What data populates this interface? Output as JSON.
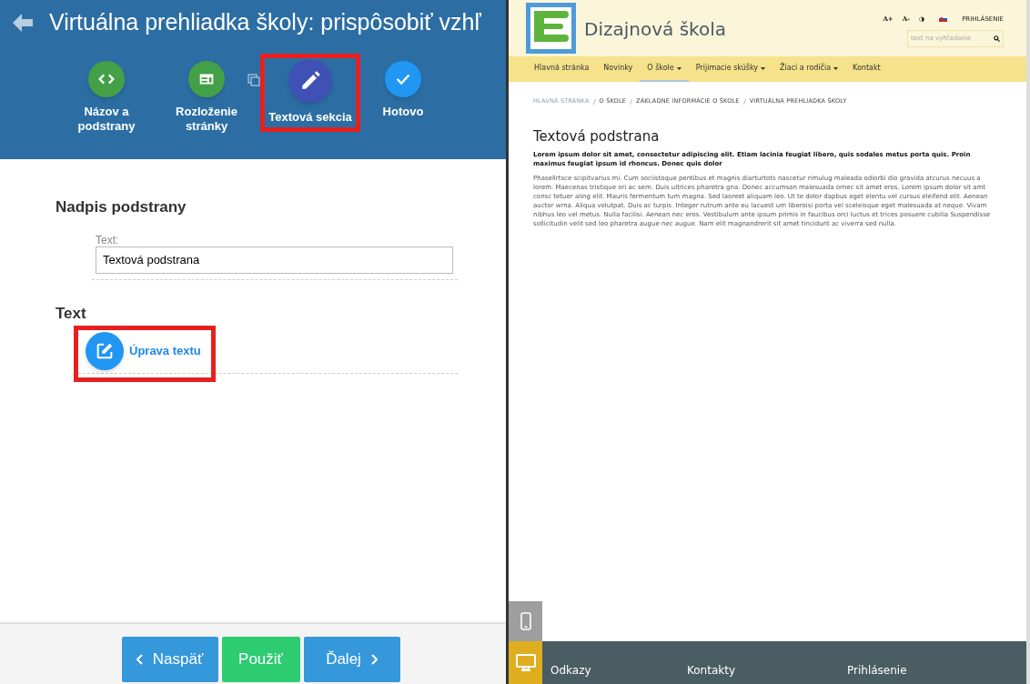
{
  "editor": {
    "title": "Virtuálna prehliadka školy: prispôsobiť vzhľ",
    "steps": [
      {
        "kind": "code",
        "label": "Názov a podstrany",
        "color": "#43a047",
        "selected": false,
        "highlighted": false
      },
      {
        "kind": "layout",
        "label": "Rozloženie stránky",
        "color": "#43a047",
        "selected": false,
        "highlighted": false
      },
      {
        "kind": "pencil",
        "label": "Textová sekcia",
        "color": "#3f51b5",
        "selected": true,
        "highlighted": true
      },
      {
        "kind": "check",
        "label": "Hotovo",
        "color": "#2196f3",
        "selected": false,
        "highlighted": false
      }
    ],
    "heading_section": {
      "title": "Nadpis podstrany",
      "field_label": "Text:",
      "field_value": "Textová podstrana"
    },
    "text_section": {
      "title": "Text",
      "edit_button": "Úprava textu",
      "highlighted": true
    },
    "buttons": [
      {
        "kind": "back",
        "label": "Naspäť",
        "color": "#3498db"
      },
      {
        "kind": "apply",
        "label": "Použiť",
        "color": "#2ecc71"
      },
      {
        "kind": "next",
        "label": "Ďalej",
        "color": "#3498db"
      }
    ]
  },
  "preview": {
    "site_title": "Dizajnová škola",
    "tools": [
      "A+",
      "A-",
      "◑"
    ],
    "login": "PRIHLÁSENIE",
    "search_placeholder": "text na vyhľadanie",
    "nav": [
      {
        "label": "Hlavná stránka",
        "dropdown": false,
        "selected": false
      },
      {
        "label": "Novinky",
        "dropdown": false,
        "selected": false
      },
      {
        "label": "O škole",
        "dropdown": true,
        "selected": true
      },
      {
        "label": "Prijimacie skúšky",
        "dropdown": true,
        "selected": false
      },
      {
        "label": "Žiaci a rodičia",
        "dropdown": true,
        "selected": false
      },
      {
        "label": "Kontakt",
        "dropdown": false,
        "selected": false
      }
    ],
    "breadcrumb": [
      "HLAVNÁ STRÁNKA",
      "O ŠKOLE",
      "ZÁKLADNÉ INFORMÁCIE O ŠKOLE",
      "VIRTUÁLNA PREHLIADKA ŠKOLY"
    ],
    "page_title": "Textová podstrana",
    "lead": "Lorem ipsum dolor sit amet, consectetur adipiscing elit. Etiam lacinia feugiat libero, quis sodales metus porta quis. Proin maximus feugiat ipsum id rhoncus. Donec quis dolor",
    "body": "Phasellrtsce scipitvarius mi. Cum sociistoque pentibus et magnis diarturtots nascetur rimulug maleada odiorbi dio gravida atcurus necuus a lorem. Maecenas tristique ori ac sem. Duis ultrices pharetra gna. Donec accumsan malesuada ornec sit amet eros. Lorem ipsum dolor sit amt consc tetuer aling elit. Mauris fermentum tum magna. Sed laoreet aliquam leo. Ut te dolor dapbus eget elentu vel cursus eleifend elit. Aenean auctor wrna. Aliqua volutpat. Duis ac turpis. Integer rutrum ante eu lacuest um liberoisi porta vel sceleisque eget malesuada at neque. Vivam nibhus leo vel metus. Nulla facilisi. Aenean nec eros. Vestibulum ante ipsum primis in faucibus orci luctus et trices posuere cubilia Suspendisse sollicitudin velit sed leo pharetra augue nec augue. Nam elit magnandrerit sit amet tincidunt ac viverra sed nulla.",
    "footer": [
      "Odkazy",
      "Kontakty",
      "Prihlásenie"
    ],
    "devices": [
      {
        "kind": "phone",
        "selected": false
      },
      {
        "kind": "desktop",
        "selected": true
      }
    ]
  }
}
